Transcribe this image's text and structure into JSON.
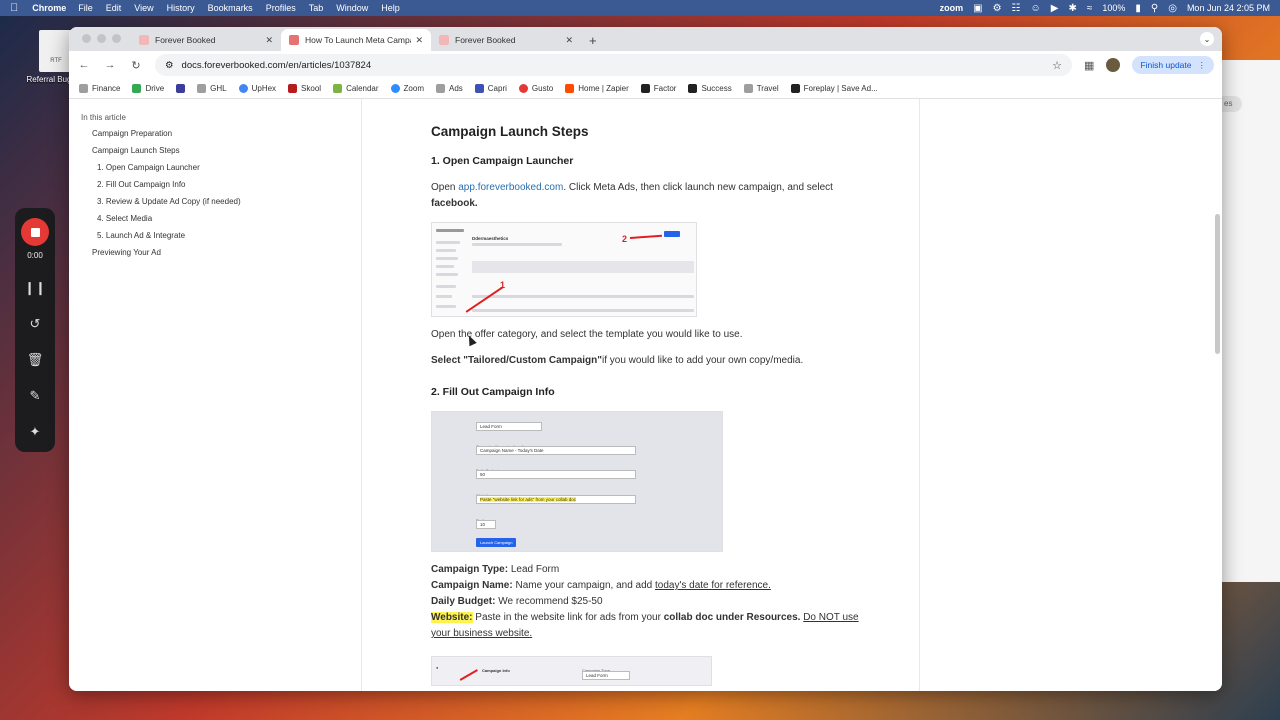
{
  "menubar": {
    "app": "Chrome",
    "items": [
      "File",
      "Edit",
      "View",
      "History",
      "Bookmarks",
      "Profiles",
      "Tab",
      "Window",
      "Help"
    ],
    "zoom_label": "zoom",
    "battery": "100%",
    "datetime": "Mon Jun 24  2:05 PM"
  },
  "desktop": {
    "file_badge": "RTF",
    "file_label": "Referral Bug"
  },
  "recorder": {
    "time": "0:00"
  },
  "tabs": [
    {
      "title": "Forever Booked"
    },
    {
      "title": "How To Launch Meta Campai"
    },
    {
      "title": "Forever Booked"
    }
  ],
  "toolbar": {
    "url": "docs.foreverbooked.com/en/articles/1037824",
    "finish_update": "Finish update"
  },
  "bookmarks": [
    {
      "label": "Finance",
      "color": "#9e9e9e"
    },
    {
      "label": "Drive",
      "color": "#34a853"
    },
    {
      "label": "",
      "color": "#3c3c9c"
    },
    {
      "label": "GHL",
      "color": "#9e9e9e"
    },
    {
      "label": "UpHex",
      "color": "#4285f4"
    },
    {
      "label": "Skool",
      "color": "#b71c1c"
    },
    {
      "label": "Calendar",
      "color": "#7cb342"
    },
    {
      "label": "Zoom",
      "color": "#2d8cff"
    },
    {
      "label": "Ads",
      "color": "#9e9e9e"
    },
    {
      "label": "Capri",
      "color": "#3f51b5"
    },
    {
      "label": "Gusto",
      "color": "#e53935"
    },
    {
      "label": "Home | Zapier",
      "color": "#ff4a00"
    },
    {
      "label": "Factor",
      "color": "#212121"
    },
    {
      "label": "Success",
      "color": "#212121"
    },
    {
      "label": "Travel",
      "color": "#9e9e9e"
    },
    {
      "label": "Foreplay | Save Ad...",
      "color": "#212121"
    }
  ],
  "toc": {
    "heading": "In this article",
    "items": [
      {
        "label": "Campaign Preparation"
      },
      {
        "label": "Campaign Launch Steps"
      },
      {
        "label": "1. Open Campaign Launcher"
      },
      {
        "label": "2. Fill Out Campaign Info"
      },
      {
        "label": "3. Review & Update Ad Copy (if needed)"
      },
      {
        "label": "4. Select Media"
      },
      {
        "label": "5. Launch Ad & Integrate"
      },
      {
        "label": "Previewing Your Ad"
      }
    ]
  },
  "article": {
    "h2": "Campaign Launch Steps",
    "step1_title": "1. Open Campaign Launcher",
    "p1_open": "Open ",
    "p1_link": "app.foreverbooked.com",
    "p1_rest": ". Click Meta Ads, then click launch new campaign, and select ",
    "p1_bold": "facebook.",
    "p2": "Open the offer category, and select the template you would like to use.",
    "p3_bold": "Select \"Tailored/Custom Campaign\"",
    "p3_rest": "if you would like to add your own copy/media.",
    "step2_title": "2. Fill Out Campaign Info",
    "type_label": "Campaign Type:",
    "type_value": " Lead Form",
    "name_label": "Campaign Name:",
    "name_value": " Name your campaign, and add ",
    "name_link": "today's date for reference.",
    "budget_label": "Daily Budget:",
    "budget_value": " We recommend $25-50",
    "website_label": "Website:",
    "website_value": " Paste in the website link for ads from your ",
    "website_bold": "collab doc under Resources.",
    "website_space": " ",
    "website_warn": "Do NOT use your business website."
  },
  "shot1": {
    "title": "Ddermaesthetics",
    "num1": "1",
    "num2": "2"
  },
  "shot2": {
    "type_label": "Campaign Type",
    "type_value": "Lead Form",
    "name_label": "Campaign Name (optional)",
    "name_value": "Campaign Name - Today's Date",
    "budget_label": "Daily Budget",
    "budget_value": "50",
    "website_label": "Website",
    "website_value": "Paste \"website link for ads\" from your collab doc",
    "radius_label": "Radius",
    "radius_value": "10",
    "launch": "Launch Campaign"
  },
  "shot3": {
    "info": "Campaign Info",
    "type": "Campaign Type",
    "value": "Lead Form"
  }
}
